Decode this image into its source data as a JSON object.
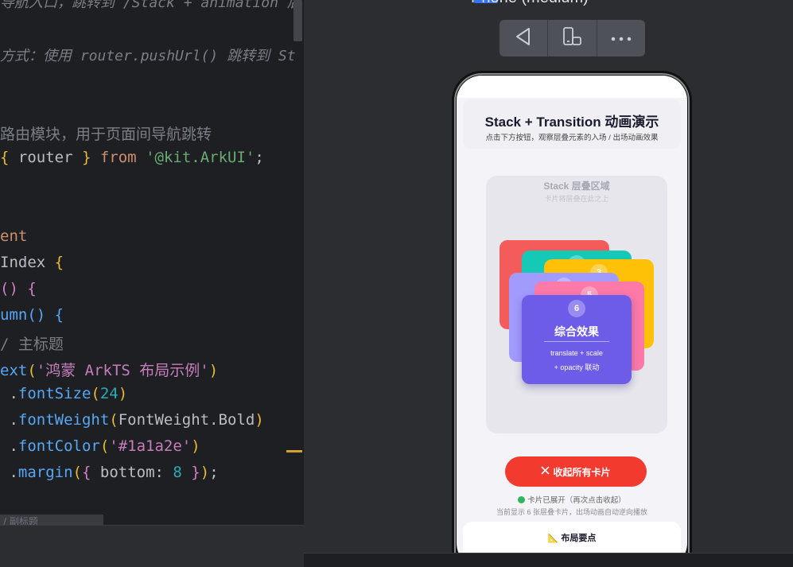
{
  "editor": {
    "lines": [
      {
        "segments": [
          {
            "t": "导航入口，跳转到 /Stack + animation 后",
            "c": "cmt"
          }
        ]
      },
      {
        "segments": [
          {
            "t": "方式：使用 router.pushUrl() 跳转到 St",
            "c": "cmt"
          }
        ]
      },
      {
        "segments": [
          {
            "t": "",
            "c": "cls"
          }
        ]
      },
      {
        "segments": [
          {
            "t": "路由模块，用于页面间导航跳转",
            "c": "cmt2"
          }
        ]
      },
      {
        "segments": [
          {
            "t": "{ ",
            "c": "brace-o"
          },
          {
            "t": "router",
            "c": "cls"
          },
          {
            "t": " }",
            "c": "brace-o"
          },
          {
            "t": " from ",
            "c": "kw"
          },
          {
            "t": "'@kit.ArkUI'",
            "c": "str"
          },
          {
            "t": ";",
            "c": "cls"
          }
        ]
      },
      {
        "segments": [
          {
            "t": "",
            "c": "cls"
          }
        ]
      },
      {
        "segments": [
          {
            "t": "",
            "c": "cls"
          }
        ]
      },
      {
        "segments": [
          {
            "t": "ent",
            "c": "kw"
          }
        ]
      },
      {
        "segments": [
          {
            "t": "Index ",
            "c": "cls"
          },
          {
            "t": "{",
            "c": "brace-o"
          }
        ]
      },
      {
        "segments": [
          {
            "t": "()",
            "c": "brace-p"
          },
          {
            "t": " {",
            "c": "brace-p"
          }
        ]
      },
      {
        "segments": [
          {
            "t": "umn",
            "c": "fn"
          },
          {
            "t": "()",
            "c": "brace-b"
          },
          {
            "t": " {",
            "c": "brace-b"
          }
        ]
      },
      {
        "segments": [
          {
            "t": "/ 主标题",
            "c": "cmt2"
          }
        ]
      },
      {
        "segments": [
          {
            "t": "ext",
            "c": "fn"
          },
          {
            "t": "(",
            "c": "brace-o"
          },
          {
            "t": "'鸿蒙 ArkTS 布局示例'",
            "c": "strp"
          },
          {
            "t": ")",
            "c": "brace-o"
          }
        ]
      },
      {
        "segments": [
          {
            "t": " .",
            "c": "cls"
          },
          {
            "t": "fontSize",
            "c": "fn"
          },
          {
            "t": "(",
            "c": "brace-o"
          },
          {
            "t": "24",
            "c": "num"
          },
          {
            "t": ")",
            "c": "brace-o"
          }
        ]
      },
      {
        "segments": [
          {
            "t": " .",
            "c": "cls"
          },
          {
            "t": "fontWeight",
            "c": "fn"
          },
          {
            "t": "(",
            "c": "brace-o"
          },
          {
            "t": "FontWeight.Bold",
            "c": "cls"
          },
          {
            "t": ")",
            "c": "brace-o"
          }
        ]
      },
      {
        "segments": [
          {
            "t": " .",
            "c": "cls"
          },
          {
            "t": "fontColor",
            "c": "fn"
          },
          {
            "t": "(",
            "c": "brace-o"
          },
          {
            "t": "'#1a1a2e'",
            "c": "strp"
          },
          {
            "t": ")",
            "c": "brace-o"
          }
        ]
      },
      {
        "segments": [
          {
            "t": " .",
            "c": "cls"
          },
          {
            "t": "margin",
            "c": "fn"
          },
          {
            "t": "(",
            "c": "brace-o"
          },
          {
            "t": "{ ",
            "c": "brace-p"
          },
          {
            "t": "bottom",
            "c": "cls"
          },
          {
            "t": ": ",
            "c": "cls"
          },
          {
            "t": "8",
            "c": "num"
          },
          {
            "t": " }",
            "c": "brace-p"
          },
          {
            "t": ")",
            "c": "brace-o"
          },
          {
            "t": ";",
            "c": "cls"
          }
        ]
      }
    ],
    "tooltip_text": "/ 副标题"
  },
  "previewer": {
    "device_title": "Phone (medium)",
    "toolbar": {
      "back_icon": "back-triangle-icon",
      "rotate_icon": "rotate-device-icon",
      "more_icon": "more-dots-icon"
    }
  },
  "app": {
    "title": "Stack + Transition 动画演示",
    "subtitle": "点击下方按钮，观察层叠元素的入场 / 出场动画效果",
    "stack_title": "Stack 层叠区域",
    "stack_subtitle": "卡片将层叠在此之上",
    "cards": [
      {
        "color": "#f45b5b",
        "badge": ""
      },
      {
        "color": "#16c9b6",
        "badge": ""
      },
      {
        "color": "#ffc107",
        "badge": "3"
      },
      {
        "color": "#a29bfe",
        "badge": ""
      },
      {
        "color": "#fd79a8",
        "badge": "5"
      },
      {
        "color": "#6c5ce7",
        "badge": "6"
      }
    ],
    "front_card": {
      "title": "综合效果",
      "desc_line1": "translate + scale",
      "desc_line2": "+ opacity 联动"
    },
    "collapse_button": "收起所有卡片",
    "status_text": "卡片已展开（再次点击收起）",
    "hint_text": "当前显示 6 张层叠卡片，出场动画自动逆向播放",
    "tips_title": "布局要点"
  }
}
